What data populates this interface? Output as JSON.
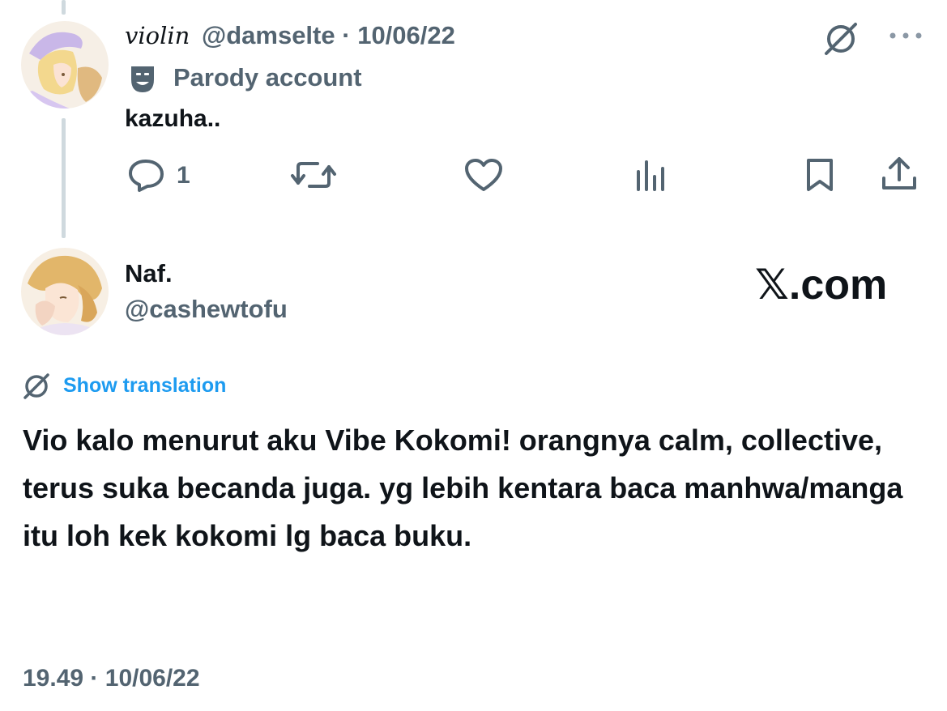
{
  "colors": {
    "text_primary": "#0f1419",
    "text_secondary": "#536471",
    "link_blue": "#1d9bf0",
    "thread_line": "#cfd9de"
  },
  "parent_tweet": {
    "display_name": "violin",
    "handle": "@damselte",
    "separator": "·",
    "date": "10/06/22",
    "label": "Parody account",
    "label_icon": "theater-mask-icon",
    "text": "kazuha..",
    "header_icons": [
      "no-translate-icon",
      "more-options-icon"
    ],
    "actions": {
      "reply_count": "1",
      "icons": [
        "reply-icon",
        "retweet-icon",
        "like-icon",
        "views-icon",
        "bookmark-icon",
        "share-icon"
      ]
    }
  },
  "main_tweet": {
    "display_name": "Naf.",
    "handle": "@cashewtofu",
    "watermark_logo": "𝕏",
    "watermark_suffix": ".com",
    "translation_icon": "translate-icon",
    "show_translation": "Show translation",
    "text": "Vio kalo menurut aku Vibe Kokomi! orangnya calm, collective, terus suka becanda juga. yg lebih kentara baca manhwa/manga itu loh kek kokomi lg baca buku.",
    "time": "19.49",
    "separator": "·",
    "date": "10/06/22"
  }
}
